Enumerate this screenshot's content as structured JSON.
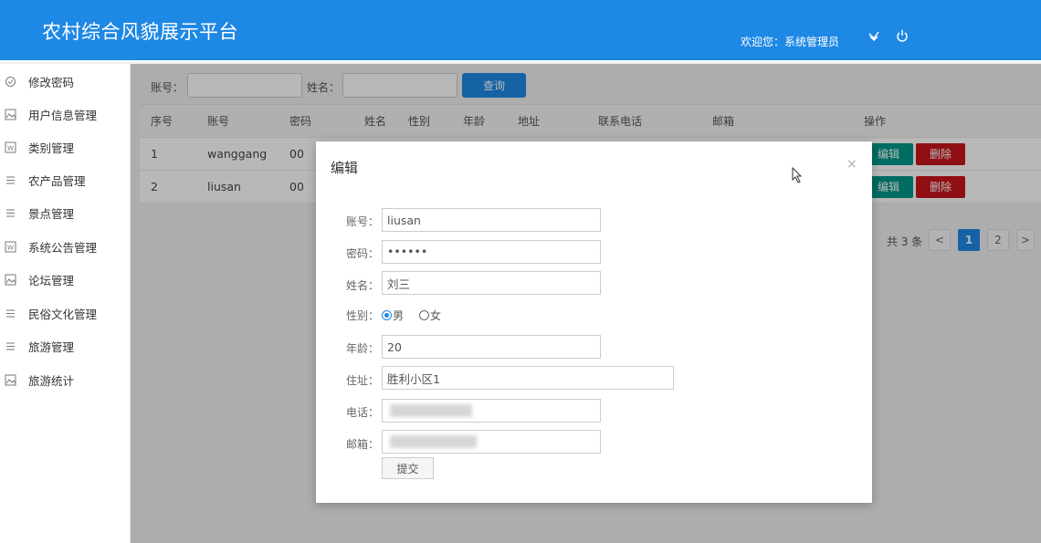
{
  "header": {
    "app_title": "农村综合风貌展示平台",
    "welcome_text": "欢迎您：系统管理员",
    "icons": [
      "theme-icon",
      "power-icon"
    ]
  },
  "sidebar": {
    "items": [
      {
        "label": "修改密码",
        "icon": "password-icon"
      },
      {
        "label": "用户信息管理",
        "icon": "image-icon"
      },
      {
        "label": "类别管理",
        "icon": "word-icon"
      },
      {
        "label": "农产品管理",
        "icon": "list-icon"
      },
      {
        "label": "景点管理",
        "icon": "list-icon"
      },
      {
        "label": "系统公告管理",
        "icon": "word-icon"
      },
      {
        "label": "论坛管理",
        "icon": "image-icon"
      },
      {
        "label": "民俗文化管理",
        "icon": "list-icon"
      },
      {
        "label": "旅游管理",
        "icon": "list-icon"
      },
      {
        "label": "旅游统计",
        "icon": "image-icon"
      }
    ]
  },
  "search": {
    "account_label": "账号：",
    "name_label": "姓名：",
    "query_button": "查询"
  },
  "table": {
    "columns": [
      "序号",
      "账号",
      "密码",
      "姓名",
      "性别",
      "年龄",
      "地址",
      "联系电话",
      "邮箱",
      "操作"
    ],
    "rows": [
      {
        "index": "1",
        "account": "wanggang",
        "password": "00"
      },
      {
        "index": "2",
        "account": "liusan",
        "password": "00"
      }
    ],
    "edit_label": "编辑",
    "delete_label": "删除"
  },
  "pagination": {
    "total": "共 3 条",
    "prev": "<",
    "pages": [
      "1",
      "2"
    ],
    "current_page": "1",
    "next": ">"
  },
  "modal": {
    "title": "编辑",
    "close": "×",
    "fields": {
      "account": {
        "label": "账号：",
        "value": "liusan"
      },
      "password": {
        "label": "密码：",
        "value": "••••••"
      },
      "name": {
        "label": "姓名：",
        "value": "刘三"
      },
      "gender": {
        "label": "性别：",
        "options": [
          "男",
          "女"
        ],
        "selected": "男"
      },
      "age": {
        "label": "年龄：",
        "value": "20"
      },
      "address": {
        "label": "住址：",
        "value": "胜利小区1"
      },
      "phone": {
        "label": "电话："
      },
      "email": {
        "label": "邮箱："
      }
    },
    "submit_label": "提交"
  },
  "colors": {
    "header_bg": "#1e88e5",
    "edit_button": "#009688",
    "delete_button": "#c8161d",
    "primary": "#1e88e5"
  }
}
